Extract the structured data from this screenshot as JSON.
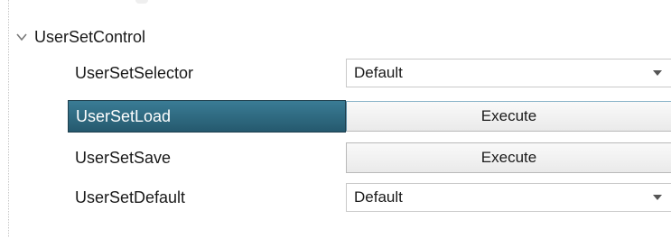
{
  "group": {
    "label": "UserSetControl",
    "expanded_icon": "chevron-down-icon"
  },
  "rows": [
    {
      "name": "UserSetSelector",
      "type": "combo",
      "value": "Default",
      "selected": false
    },
    {
      "name": "UserSetLoad",
      "type": "button",
      "value": "Execute",
      "selected": true
    },
    {
      "name": "UserSetSave",
      "type": "button",
      "value": "Execute",
      "selected": false
    },
    {
      "name": "UserSetDefault",
      "type": "combo",
      "value": "Default",
      "selected": false
    }
  ],
  "colors": {
    "selected_row": "#2f6d85",
    "text": "#1a1a1a"
  }
}
